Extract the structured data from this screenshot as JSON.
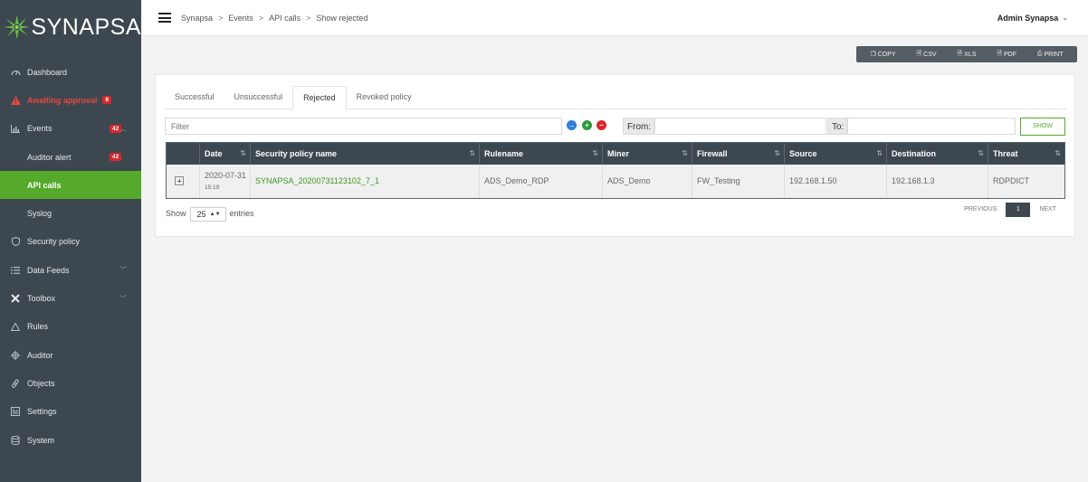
{
  "brand": {
    "name": "SYNAPSA"
  },
  "sidebar": {
    "items": [
      {
        "label": "Dashboard",
        "icon": "dashboard-icon"
      },
      {
        "label": "Awaiting approval",
        "icon": "warning-icon",
        "badge": "8"
      },
      {
        "label": "Events",
        "icon": "bar-chart-icon",
        "badge": "42"
      },
      {
        "label": "Auditor alert",
        "badge": "42"
      },
      {
        "label": "API calls"
      },
      {
        "label": "Syslog"
      },
      {
        "label": "Security policy",
        "icon": "shield-icon"
      },
      {
        "label": "Data Feeds",
        "icon": "list-icon"
      },
      {
        "label": "Toolbox",
        "icon": "tools-icon"
      },
      {
        "label": "Rules",
        "icon": "triangle-icon"
      },
      {
        "label": "Auditor",
        "icon": "crosshair-icon"
      },
      {
        "label": "Objects",
        "icon": "link-icon"
      },
      {
        "label": "Settings",
        "icon": "settings-icon"
      },
      {
        "label": "System",
        "icon": "database-icon"
      }
    ]
  },
  "header": {
    "breadcrumb": [
      "Synapsa",
      "Events",
      "API calls",
      "Show rejected"
    ],
    "separator": ">",
    "user": "Admin Synapsa"
  },
  "export_buttons": [
    "COPY",
    "CSV",
    "XLS",
    "PDF",
    "PRINT"
  ],
  "tabs": [
    "Successful",
    "Unsuccessful",
    "Rejected",
    "Revoked policy"
  ],
  "filter": {
    "placeholder": "Filter",
    "from_label": "From:",
    "to_label": "To:",
    "show_label": "SHOW"
  },
  "table": {
    "columns": [
      "Date",
      "Security policy name",
      "Rulename",
      "Miner",
      "Firewall",
      "Source",
      "Destination",
      "Threat"
    ],
    "rows": [
      {
        "date": "2020-07-31",
        "time": "15:19",
        "policy": "SYNAPSA_20200731123102_7_1",
        "rulename": "ADS_Demo_RDP",
        "miner": "ADS_Demo",
        "firewall": "FW_Testing",
        "source": "192.168.1.50",
        "destination": "192.168.1.3",
        "threat": "RDPDICT"
      }
    ]
  },
  "pagination": {
    "show_label": "Show",
    "page_size": "25",
    "entries_label": "entries",
    "previous": "PREVIOUS",
    "current": "1",
    "next": "NEXT"
  }
}
